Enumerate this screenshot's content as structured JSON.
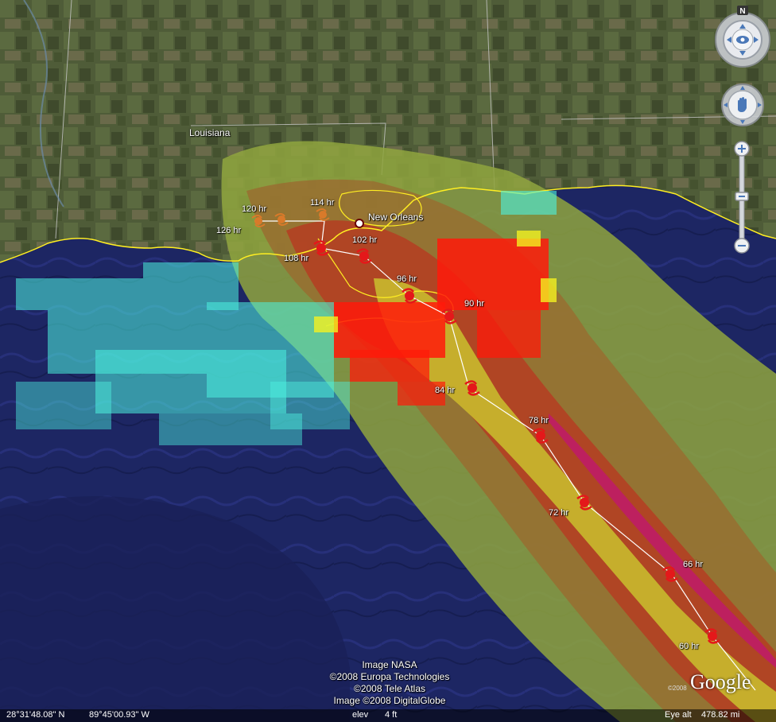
{
  "map": {
    "place_label": "Louisiana",
    "city_label": "New Orleans",
    "forecast_points": [
      {
        "label": "120 hr"
      },
      {
        "label": "114 hr"
      },
      {
        "label": "126 hr"
      },
      {
        "label": "102 hr"
      },
      {
        "label": "108 hr"
      },
      {
        "label": "96 hr"
      },
      {
        "label": "90 hr"
      },
      {
        "label": "84 hr"
      },
      {
        "label": "78 hr"
      },
      {
        "label": "72 hr"
      },
      {
        "label": "66 hr"
      },
      {
        "label": "60 hr"
      }
    ]
  },
  "credits": {
    "line1": "Image NASA",
    "line2": "©2008 Europa Technologies",
    "line3": "©2008 Tele Atlas",
    "line4": "Image ©2008 DigitalGlobe"
  },
  "logo": {
    "text": "Google",
    "copyright": "©2008"
  },
  "status": {
    "latitude": "28°31'48.08\" N",
    "longitude": "89°45'00.93\" W",
    "elev_label": "elev",
    "elev_value": "4 ft",
    "eye_alt_label": "Eye alt",
    "eye_alt_value": "478.82 mi"
  },
  "controls": {
    "north_label": "N"
  },
  "colors": {
    "ocean": "#1c2560",
    "land": "#4d5a36",
    "cone_outer": "#8aa640",
    "cone_mid": "#9a6a2e",
    "cone_inner": "#b53a22",
    "cone_core": "#c8b82c",
    "track": "#ffffff",
    "coast": "#ffee22",
    "platform_red": "#ff1a0a",
    "platform_cyan": "#4df2e0",
    "platform_yellow": "#f4f020"
  }
}
